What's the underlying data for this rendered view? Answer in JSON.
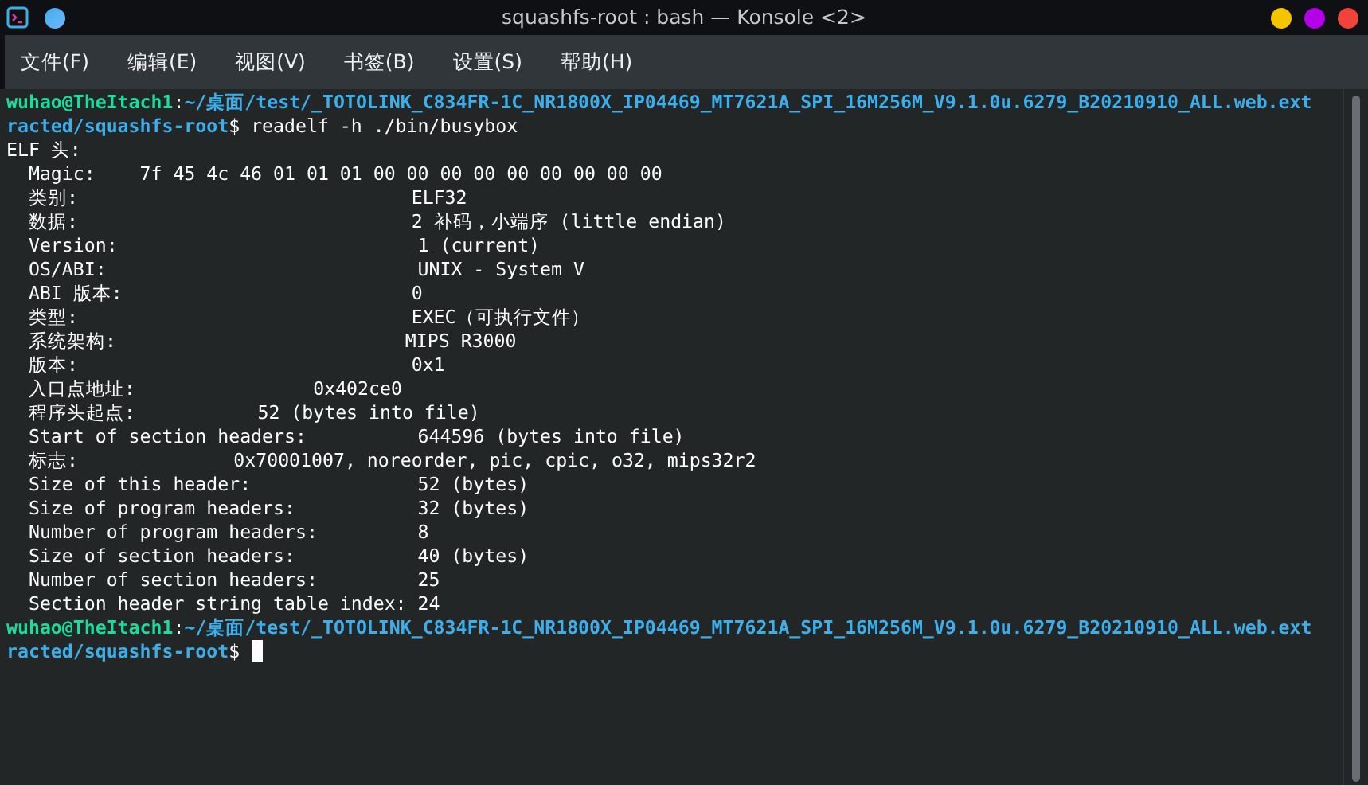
{
  "window": {
    "title": "squashfs-root : bash — Konsole <2>"
  },
  "menu": [
    "文件(F)",
    "编辑(E)",
    "视图(V)",
    "书签(B)",
    "设置(S)",
    "帮助(H)"
  ],
  "terminal": {
    "lines": [
      {
        "segments": [
          {
            "kind": "user",
            "text": "wuhao@TheItach1"
          },
          {
            "kind": "plain",
            "text": ":"
          },
          {
            "kind": "path",
            "text": "~/桌面/test/_TOTOLINK_C834FR-1C_NR1800X_IP04469_MT7621A_SPI_16M256M_V9.1.0u.6279_B20210910_ALL.web.ext"
          }
        ]
      },
      {
        "segments": [
          {
            "kind": "path",
            "text": "racted/squashfs-root"
          },
          {
            "kind": "plain",
            "text": "$ readelf -h ./bin/busybox"
          }
        ]
      },
      {
        "segments": [
          {
            "kind": "plain",
            "text": "ELF 头:"
          }
        ]
      },
      {
        "segments": [
          {
            "kind": "plain",
            "text": "  Magic:    7f 45 4c 46 01 01 01 00 00 00 00 00 00 00 00 00"
          }
        ]
      },
      {
        "segments": [
          {
            "kind": "plain",
            "text": "  类别:                              ELF32"
          }
        ]
      },
      {
        "segments": [
          {
            "kind": "plain",
            "text": "  数据:                              2 补码，小端序 (little endian)"
          }
        ]
      },
      {
        "segments": [
          {
            "kind": "plain",
            "text": "  Version:                           1 (current)"
          }
        ]
      },
      {
        "segments": [
          {
            "kind": "plain",
            "text": "  OS/ABI:                            UNIX - System V"
          }
        ]
      },
      {
        "segments": [
          {
            "kind": "plain",
            "text": "  ABI 版本:                          0"
          }
        ]
      },
      {
        "segments": [
          {
            "kind": "plain",
            "text": "  类型:                              EXEC（可执行文件）"
          }
        ]
      },
      {
        "segments": [
          {
            "kind": "plain",
            "text": "  系统架构:                          MIPS R3000"
          }
        ]
      },
      {
        "segments": [
          {
            "kind": "plain",
            "text": "  版本:                              0x1"
          }
        ]
      },
      {
        "segments": [
          {
            "kind": "plain",
            "text": "  入口点地址:                0x402ce0"
          }
        ]
      },
      {
        "segments": [
          {
            "kind": "plain",
            "text": "  程序头起点:           52 (bytes into file)"
          }
        ]
      },
      {
        "segments": [
          {
            "kind": "plain",
            "text": "  Start of section headers:          644596 (bytes into file)"
          }
        ]
      },
      {
        "segments": [
          {
            "kind": "plain",
            "text": "  标志:              0x70001007, noreorder, pic, cpic, o32, mips32r2"
          }
        ]
      },
      {
        "segments": [
          {
            "kind": "plain",
            "text": "  Size of this header:               52 (bytes)"
          }
        ]
      },
      {
        "segments": [
          {
            "kind": "plain",
            "text": "  Size of program headers:           32 (bytes)"
          }
        ]
      },
      {
        "segments": [
          {
            "kind": "plain",
            "text": "  Number of program headers:         8"
          }
        ]
      },
      {
        "segments": [
          {
            "kind": "plain",
            "text": "  Size of section headers:           40 (bytes)"
          }
        ]
      },
      {
        "segments": [
          {
            "kind": "plain",
            "text": "  Number of section headers:         25"
          }
        ]
      },
      {
        "segments": [
          {
            "kind": "plain",
            "text": "  Section header string table index: 24"
          }
        ]
      },
      {
        "segments": [
          {
            "kind": "user",
            "text": "wuhao@TheItach1"
          },
          {
            "kind": "plain",
            "text": ":"
          },
          {
            "kind": "path",
            "text": "~/桌面/test/_TOTOLINK_C834FR-1C_NR1800X_IP04469_MT7621A_SPI_16M256M_V9.1.0u.6279_B20210910_ALL.web.ext"
          }
        ]
      },
      {
        "segments": [
          {
            "kind": "path",
            "text": "racted/squashfs-root"
          },
          {
            "kind": "plain",
            "text": "$ "
          }
        ],
        "cursor": true
      }
    ]
  }
}
